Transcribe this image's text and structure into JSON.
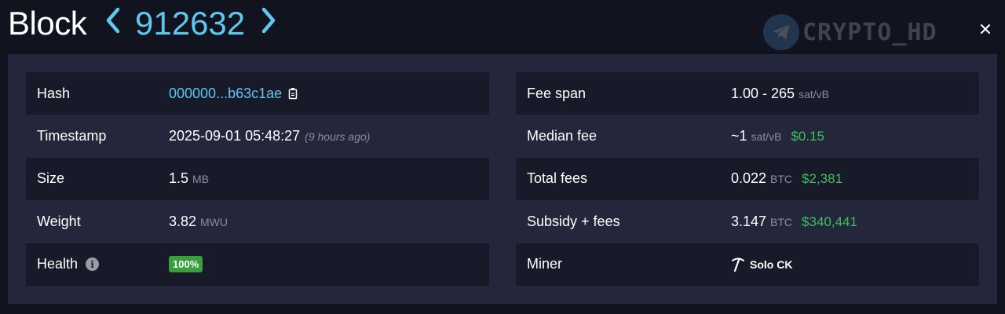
{
  "header": {
    "title": "Block",
    "block_height": "912632",
    "watermark_text": "CRYPTO_HD",
    "close_symbol": "×",
    "accent_color": "#5fc8ef"
  },
  "left_table": {
    "hash": {
      "label": "Hash",
      "value": "000000...b63c1ae"
    },
    "timestamp": {
      "label": "Timestamp",
      "value": "2025-09-01 05:48:27",
      "relative": "(9 hours ago)"
    },
    "size": {
      "label": "Size",
      "value": "1.5",
      "unit": "MB"
    },
    "weight": {
      "label": "Weight",
      "value": "3.82",
      "unit": "MWU"
    },
    "health": {
      "label": "Health",
      "value": "100%",
      "badge_color": "#3a9d3e"
    }
  },
  "right_table": {
    "fee_span": {
      "label": "Fee span",
      "value": "1.00 - 265",
      "unit": "sat/vB"
    },
    "median_fee": {
      "label": "Median fee",
      "value": "~1",
      "unit": "sat/vB",
      "fiat": "$0.15"
    },
    "total_fees": {
      "label": "Total fees",
      "value": "0.022",
      "unit": "BTC",
      "fiat": "$2,381"
    },
    "subsidy_fees": {
      "label": "Subsidy + fees",
      "value": "3.147",
      "unit": "BTC",
      "fiat": "$340,441"
    },
    "miner": {
      "label": "Miner",
      "value": "Solo CK"
    }
  },
  "icons": {
    "prev": "chevron-left-icon",
    "next": "chevron-right-icon",
    "copy": "copy-icon",
    "info": "info-icon",
    "pickaxe": "pickaxe-icon",
    "telegram": "telegram-icon",
    "close": "close-icon"
  },
  "colors": {
    "background": "#11131f",
    "panel": "#24273b",
    "row_odd": "#181a2a",
    "fiat_green": "#3fbf5f"
  }
}
